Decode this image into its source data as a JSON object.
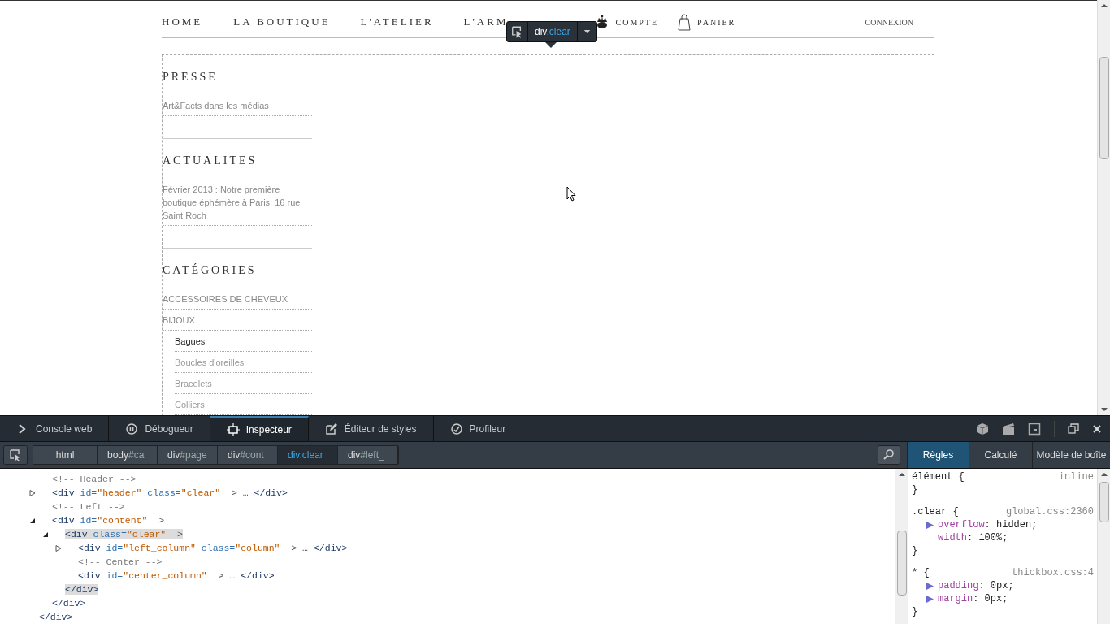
{
  "nav": {
    "items": [
      {
        "label": "HOME"
      },
      {
        "label": "LA BOUTIQUE"
      },
      {
        "label": "L'ATELIER"
      },
      {
        "label": "L'ARM"
      }
    ],
    "account": [
      {
        "kind": "crown",
        "label": "COMPTE"
      },
      {
        "kind": "bag",
        "label": "PANIER"
      }
    ],
    "login": "CONNEXION"
  },
  "highlighter": {
    "tag": "div",
    "cls": ".clear"
  },
  "sidebar": [
    {
      "title": "PRESSE",
      "links": [
        {
          "label": "Art&Facts dans les médias"
        }
      ]
    },
    {
      "title": "ACTUALITES",
      "links": [
        {
          "label": "Février 2013 : Notre première boutique éphémère à Paris, 16 rue Saint Roch"
        }
      ]
    },
    {
      "title": "CATÉGORIES",
      "links": [
        {
          "label": "ACCESSOIRES DE CHEVEUX"
        },
        {
          "label": "BIJOUX",
          "children": [
            {
              "label": "Bagues",
              "selected": true
            },
            {
              "label": "Boucles d'oreilles",
              "selected": false
            },
            {
              "label": "Bracelets",
              "selected": false
            },
            {
              "label": "Colliers",
              "selected": false
            }
          ]
        }
      ]
    }
  ],
  "devtools": {
    "tabs": [
      {
        "kind": "console",
        "label": "Console web",
        "selected": false
      },
      {
        "kind": "debugger",
        "label": "Débogueur",
        "selected": false
      },
      {
        "kind": "inspector",
        "label": "Inspecteur",
        "selected": true
      },
      {
        "kind": "style",
        "label": "Éditeur de styles",
        "selected": false
      },
      {
        "kind": "profiler",
        "label": "Profileur",
        "selected": false
      }
    ],
    "breadcrumbs": [
      {
        "tag": "html",
        "selected": false
      },
      {
        "tag": "body",
        "suffix": "#ca",
        "selected": false
      },
      {
        "tag": "div",
        "suffix": "#page",
        "selected": false
      },
      {
        "tag": "div",
        "suffix": "#cont",
        "selected": false
      },
      {
        "tag": "div",
        "suffix": ".clear",
        "selected": true
      },
      {
        "tag": "div",
        "suffix": "#left_",
        "selected": false
      }
    ],
    "side_tabs": [
      {
        "label": "Règles",
        "selected": true
      },
      {
        "label": "Calculé",
        "selected": false
      },
      {
        "label": "Modèle de boîte",
        "selected": false
      }
    ],
    "markup": [
      {
        "close": [
          {
            "kind": "tag",
            "text": "</div>"
          }
        ],
        "children": [
          {
            "open": [
              {
                "kind": "comment",
                "text": "<!-- Header -->"
              }
            ]
          },
          {
            "expanded": false,
            "selected": false,
            "open": [
              {
                "kind": "tag",
                "text": "<div "
              },
              {
                "kind": "attr",
                "text": "id="
              },
              {
                "kind": "value",
                "text": "\"header\" "
              },
              {
                "kind": "attr",
                "text": "class="
              },
              {
                "kind": "value",
                "text": "\"clear\""
              },
              {
                "kind": "punct",
                "text": "  > … "
              },
              {
                "kind": "tag",
                "text": "</div>"
              }
            ]
          },
          {
            "open": [
              {
                "kind": "comment",
                "text": "<!-- Left -->"
              }
            ]
          },
          {
            "expanded": true,
            "selected": false,
            "open": [
              {
                "kind": "tag",
                "text": "<div "
              },
              {
                "kind": "attr",
                "text": "id="
              },
              {
                "kind": "value",
                "text": "\"content\""
              },
              {
                "kind": "punct",
                "text": "  >"
              }
            ],
            "close": [
              {
                "kind": "tag",
                "text": "</div>"
              }
            ],
            "children": [
              {
                "expanded": true,
                "selected": true,
                "open": [
                  {
                    "kind": "tag",
                    "text": "<div "
                  },
                  {
                    "kind": "attr",
                    "text": "class="
                  },
                  {
                    "kind": "value",
                    "text": "\"clear\""
                  },
                  {
                    "kind": "punct",
                    "text": "  >"
                  }
                ],
                "close": [
                  {
                    "kind": "tag",
                    "text": "</div>"
                  }
                ],
                "children": [
                  {
                    "expanded": false,
                    "selected": false,
                    "open": [
                      {
                        "kind": "tag",
                        "text": "<div "
                      },
                      {
                        "kind": "attr",
                        "text": "id="
                      },
                      {
                        "kind": "value",
                        "text": "\"left_column\" "
                      },
                      {
                        "kind": "attr",
                        "text": "class="
                      },
                      {
                        "kind": "value",
                        "text": "\"column\""
                      },
                      {
                        "kind": "punct",
                        "text": "  > … "
                      },
                      {
                        "kind": "tag",
                        "text": "</div>"
                      }
                    ]
                  },
                  {
                    "open": [
                      {
                        "kind": "comment",
                        "text": "<!-- Center -->"
                      }
                    ]
                  },
                  {
                    "selected": false,
                    "open": [
                      {
                        "kind": "tag",
                        "text": "<div "
                      },
                      {
                        "kind": "attr",
                        "text": "id="
                      },
                      {
                        "kind": "value",
                        "text": "\"center_column\""
                      },
                      {
                        "kind": "punct",
                        "text": "  > … "
                      },
                      {
                        "kind": "tag",
                        "text": "</div>"
                      }
                    ]
                  }
                ]
              }
            ]
          }
        ]
      }
    ],
    "rules": [
      {
        "selector": "élément {",
        "source": "inline",
        "close": "}"
      },
      {
        "selector": ".clear {",
        "source": "global.css:2360",
        "close": "}",
        "declarations": [
          {
            "prop": "overflow",
            "rest": ": hidden;",
            "expandable": true
          },
          {
            "prop": "width",
            "rest": ": 100%;",
            "expandable": false
          }
        ]
      },
      {
        "selector": "* {",
        "source": "thickbox.css:4",
        "close": "}",
        "declarations": [
          {
            "prop": "padding",
            "rest": ": 0px;",
            "expandable": true
          },
          {
            "prop": "margin",
            "rest": ": 0px;",
            "expandable": true
          }
        ]
      }
    ]
  }
}
